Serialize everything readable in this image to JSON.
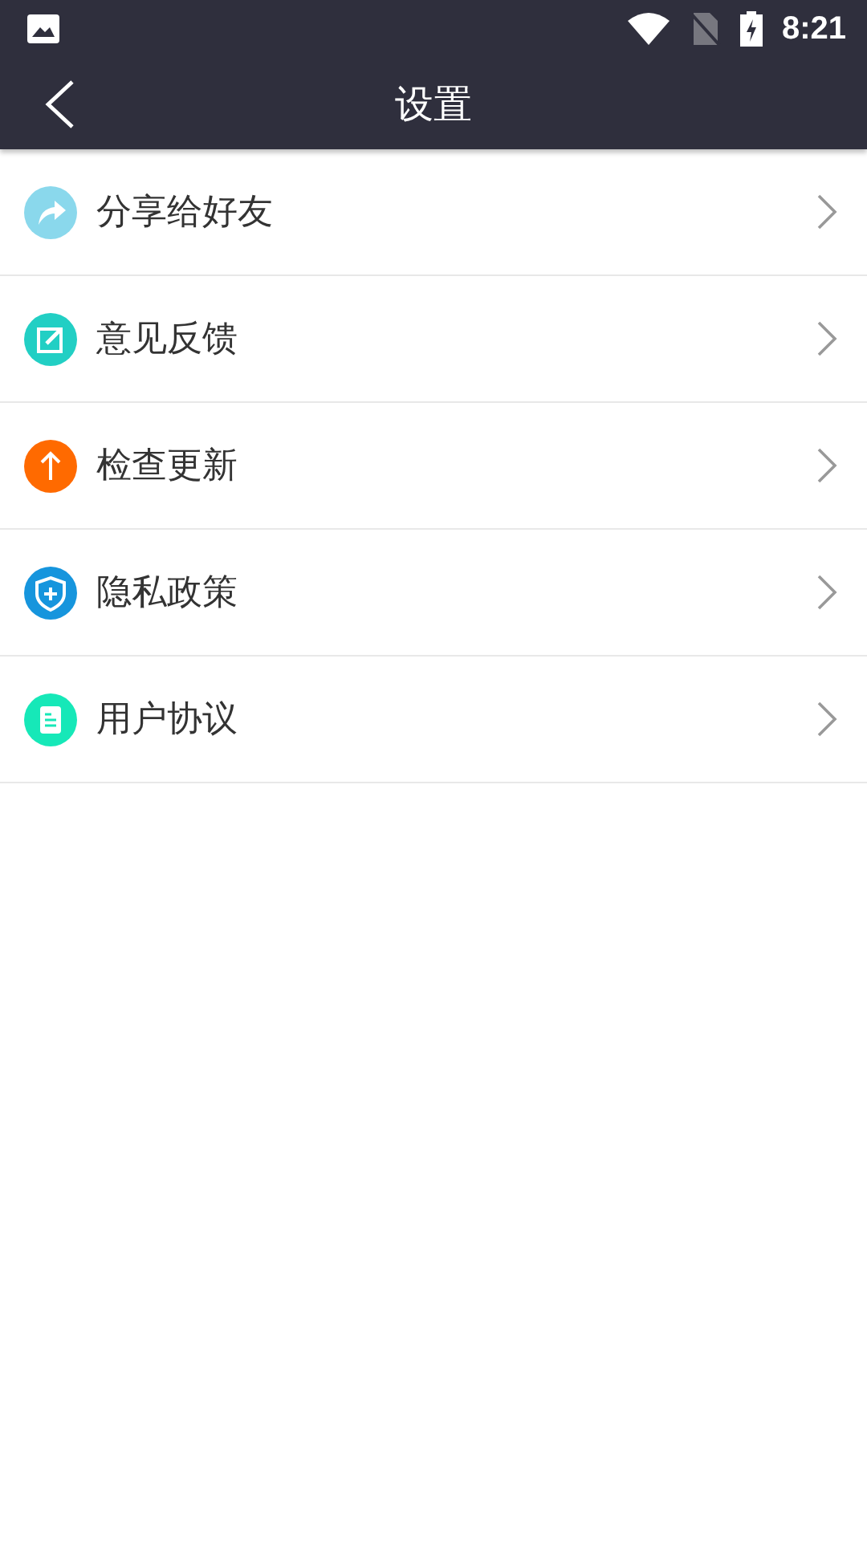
{
  "status_bar": {
    "time": "8:21"
  },
  "header": {
    "title": "设置"
  },
  "items": [
    {
      "label": "分享给好友",
      "kind": "share",
      "color": "#8ad8ec"
    },
    {
      "label": "意见反馈",
      "kind": "edit",
      "color": "#22cfc4"
    },
    {
      "label": "检查更新",
      "kind": "update",
      "color": "#ff6a00"
    },
    {
      "label": "隐私政策",
      "kind": "shield",
      "color": "#1695dd"
    },
    {
      "label": "用户协议",
      "kind": "document",
      "color": "#16e8b8"
    }
  ]
}
